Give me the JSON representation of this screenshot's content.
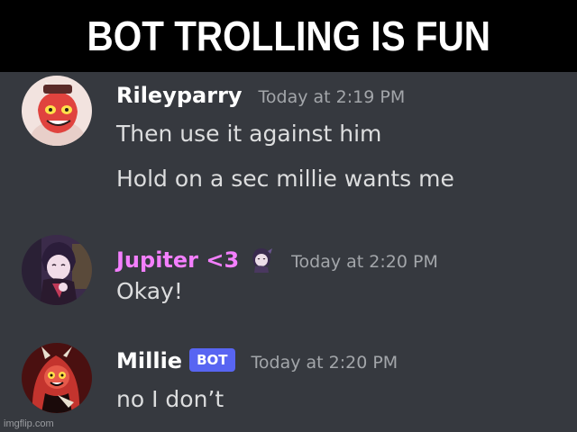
{
  "banner": {
    "title": "BOT TROLLING IS FUN"
  },
  "messages": [
    {
      "username": "Rileyparry",
      "timestamp": "Today at 2:19 PM",
      "lines": [
        "Then use it against him",
        "Hold on a sec millie wants me"
      ],
      "avatar_icon": "avatar-rileyparry",
      "name_color": "#ffffff"
    },
    {
      "username": "Jupiter <3",
      "timestamp": "Today at 2:20 PM",
      "lines": [
        "Okay!"
      ],
      "avatar_icon": "avatar-jupiter",
      "name_color": "#f47fff",
      "badge_icon": "character-emoji-icon"
    },
    {
      "username": "Millie",
      "bot_tag": "BOT",
      "timestamp": "Today at 2:20 PM",
      "lines": [
        "no I don’t"
      ],
      "avatar_icon": "avatar-millie",
      "name_color": "#ffffff"
    }
  ],
  "watermark": "imgflip.com",
  "colors": {
    "background": "#36393f",
    "banner": "#000000",
    "text": "#dcddde",
    "timestamp": "#a3a6aa",
    "bot_tag": "#5865f2"
  }
}
